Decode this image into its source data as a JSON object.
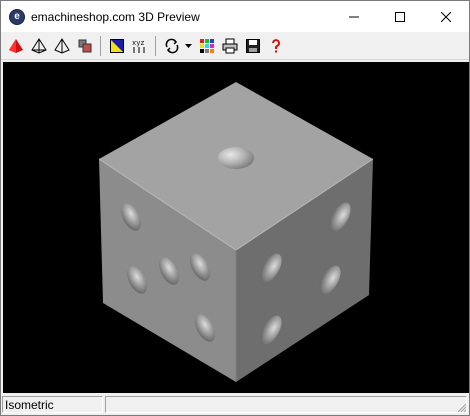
{
  "window": {
    "title": "emachineshop.com 3D Preview",
    "app_icon_letter": "e"
  },
  "toolbar": {
    "buttons": [
      {
        "name": "solid-view-button",
        "icon": "solid-cone-icon"
      },
      {
        "name": "wireframe-view-button",
        "icon": "wireframe-cone-icon"
      },
      {
        "name": "outline-view-button",
        "icon": "outline-cone-icon"
      },
      {
        "name": "material-view-button",
        "icon": "blocks-icon"
      },
      {
        "name": "color-scheme-button",
        "icon": "color-fill-icon"
      },
      {
        "name": "axes-button",
        "icon": "xyz-axes-icon"
      },
      {
        "name": "rotate-button",
        "icon": "rotate-icon"
      },
      {
        "name": "rotate-dropdown-button",
        "icon": "dropdown-arrow-icon"
      },
      {
        "name": "color-palette-button",
        "icon": "palette-icon"
      },
      {
        "name": "print-button",
        "icon": "printer-icon"
      },
      {
        "name": "save-button",
        "icon": "floppy-icon"
      },
      {
        "name": "help-button",
        "icon": "help-icon"
      }
    ],
    "axes_label": "xyz"
  },
  "colors": {
    "viewport_bg": "#000000",
    "die_top": "#a3a3a3",
    "die_left": "#8a8a8a",
    "die_right": "#6e6e6e"
  },
  "statusbar": {
    "view_mode": "Isometric"
  }
}
